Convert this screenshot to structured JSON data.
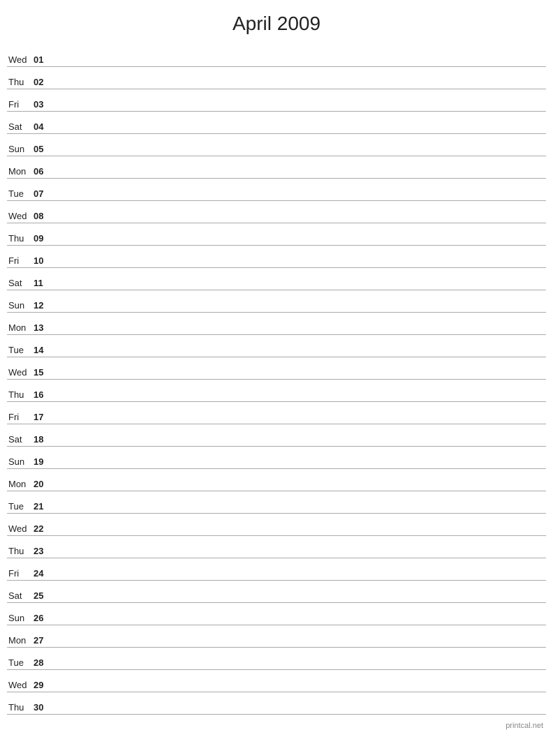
{
  "title": "April 2009",
  "footer": "printcal.net",
  "days": [
    {
      "name": "Wed",
      "num": "01"
    },
    {
      "name": "Thu",
      "num": "02"
    },
    {
      "name": "Fri",
      "num": "03"
    },
    {
      "name": "Sat",
      "num": "04"
    },
    {
      "name": "Sun",
      "num": "05"
    },
    {
      "name": "Mon",
      "num": "06"
    },
    {
      "name": "Tue",
      "num": "07"
    },
    {
      "name": "Wed",
      "num": "08"
    },
    {
      "name": "Thu",
      "num": "09"
    },
    {
      "name": "Fri",
      "num": "10"
    },
    {
      "name": "Sat",
      "num": "11"
    },
    {
      "name": "Sun",
      "num": "12"
    },
    {
      "name": "Mon",
      "num": "13"
    },
    {
      "name": "Tue",
      "num": "14"
    },
    {
      "name": "Wed",
      "num": "15"
    },
    {
      "name": "Thu",
      "num": "16"
    },
    {
      "name": "Fri",
      "num": "17"
    },
    {
      "name": "Sat",
      "num": "18"
    },
    {
      "name": "Sun",
      "num": "19"
    },
    {
      "name": "Mon",
      "num": "20"
    },
    {
      "name": "Tue",
      "num": "21"
    },
    {
      "name": "Wed",
      "num": "22"
    },
    {
      "name": "Thu",
      "num": "23"
    },
    {
      "name": "Fri",
      "num": "24"
    },
    {
      "name": "Sat",
      "num": "25"
    },
    {
      "name": "Sun",
      "num": "26"
    },
    {
      "name": "Mon",
      "num": "27"
    },
    {
      "name": "Tue",
      "num": "28"
    },
    {
      "name": "Wed",
      "num": "29"
    },
    {
      "name": "Thu",
      "num": "30"
    }
  ]
}
